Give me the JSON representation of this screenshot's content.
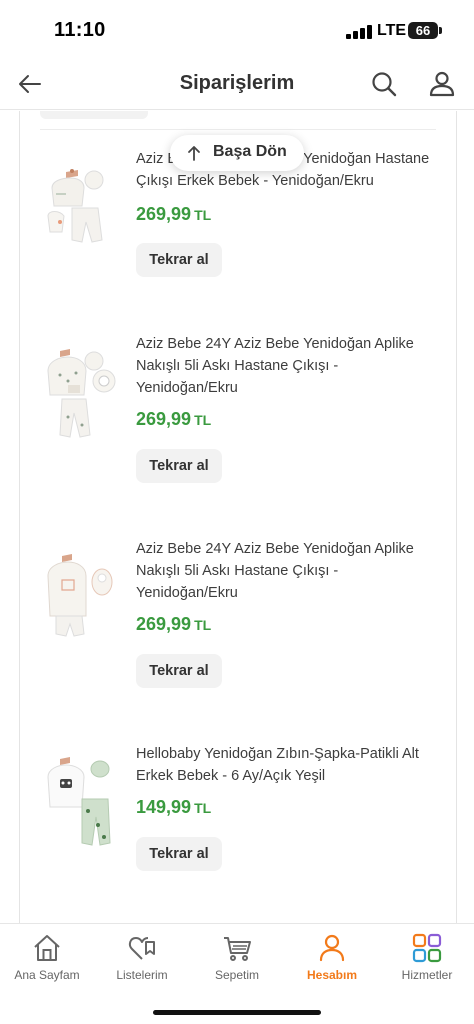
{
  "status_bar": {
    "time": "11:10",
    "network": "LTE",
    "battery": "66"
  },
  "header": {
    "title": "Siparişlerim",
    "back_icon": "arrow-left-icon",
    "search_icon": "search-icon",
    "user_icon": "user-icon"
  },
  "back_to_top": {
    "label": "Başa Dön"
  },
  "orders": [
    {
      "title": "Aziz Bebe 24Y Aziz Bebe Yenidoğan Hastane Çıkışı Erkek Bebek - Yenidoğan/Ekru",
      "price": "269,99",
      "currency": "TL",
      "button": "Tekrar al"
    },
    {
      "title": "Aziz Bebe 24Y Aziz Bebe Yenidoğan Aplike Nakışlı 5li Askı Hastane Çıkışı - Yenidoğan/Ekru",
      "price": "269,99",
      "currency": "TL",
      "button": "Tekrar al"
    },
    {
      "title": "Aziz Bebe 24Y Aziz Bebe Yenidoğan Aplike Nakışlı 5li Askı Hastane Çıkışı - Yenidoğan/Ekru",
      "price": "269,99",
      "currency": "TL",
      "button": "Tekrar al"
    },
    {
      "title": "Hellobaby Yenidoğan Zıbın-Şapka-Patikli Alt Erkek Bebek - 6 Ay/Açık Yeşil",
      "price": "149,99",
      "currency": "TL",
      "button": "Tekrar al"
    }
  ],
  "tabs": [
    {
      "label": "Ana Sayfam",
      "icon": "home-icon"
    },
    {
      "label": "Listelerim",
      "icon": "heart-list-icon"
    },
    {
      "label": "Sepetim",
      "icon": "cart-icon"
    },
    {
      "label": "Hesabım",
      "icon": "account-icon",
      "active": true
    },
    {
      "label": "Hizmetler",
      "icon": "services-icon"
    }
  ],
  "colors": {
    "price": "#3a9a3f",
    "accent": "#f27a1a"
  }
}
